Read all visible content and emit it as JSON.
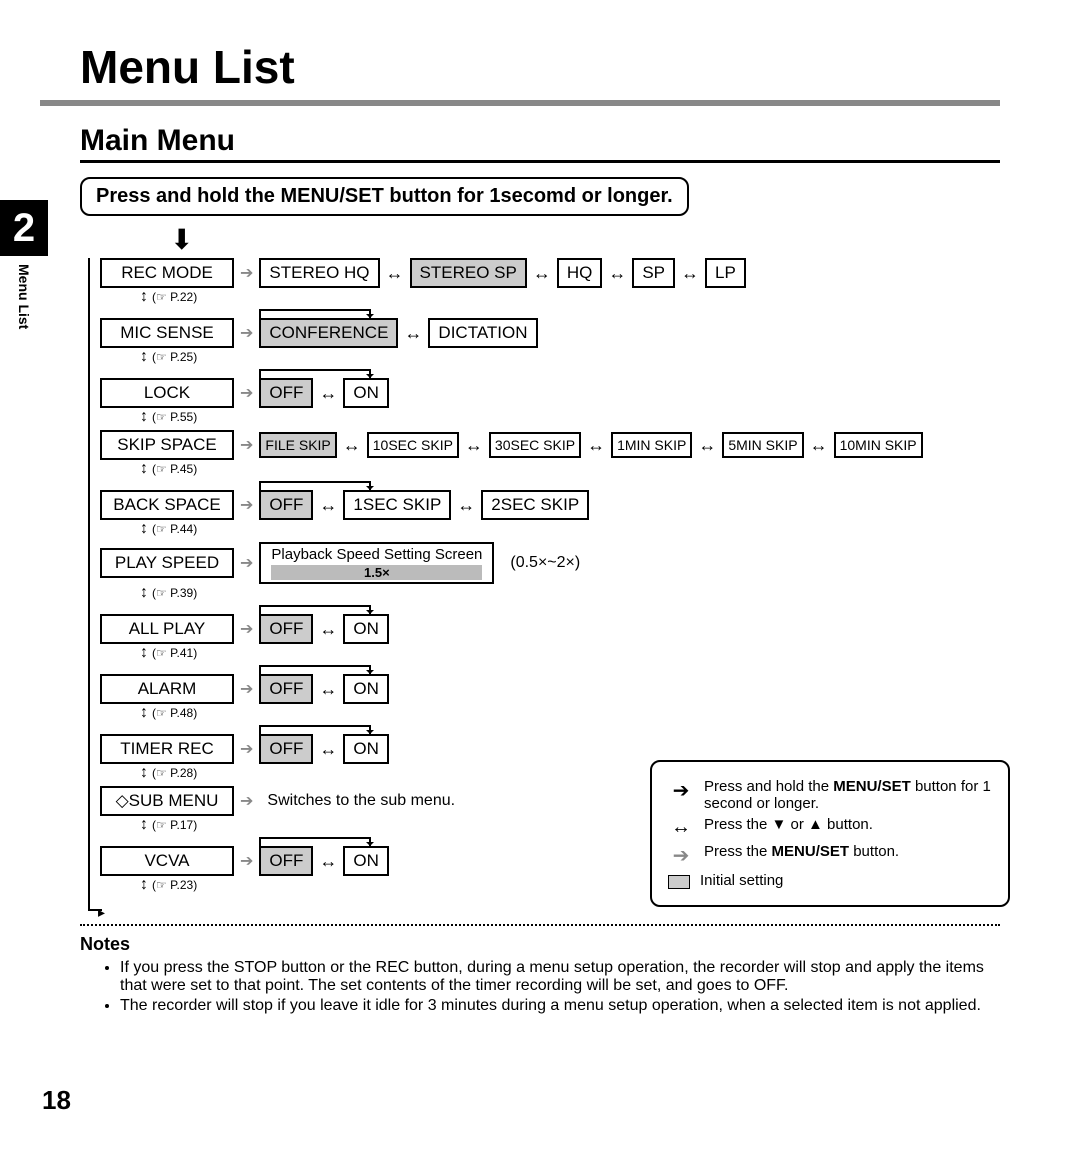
{
  "page": {
    "title": "Menu List",
    "subtitle": "Main Menu",
    "instruction": "Press and hold the MENU/SET button for 1secomd or longer.",
    "section_number": "2",
    "side_label": "Menu List",
    "page_number": "18"
  },
  "menu": [
    {
      "label": "REC MODE",
      "ref": "(☞ P.22)",
      "options": [
        "STEREO HQ",
        "STEREO SP",
        "HQ",
        "SP",
        "LP"
      ],
      "initial_idx": 1
    },
    {
      "label": "MIC SENSE",
      "ref": "(☞ P.25)",
      "options": [
        "CONFERENCE",
        "DICTATION"
      ],
      "initial_idx": 0,
      "loop": true
    },
    {
      "label": "LOCK",
      "ref": "(☞ P.55)",
      "options": [
        "OFF",
        "ON"
      ],
      "initial_idx": 0,
      "loop": true
    },
    {
      "label": "SKIP SPACE",
      "ref": "(☞ P.45)",
      "options": [
        "FILE SKIP",
        "10SEC SKIP",
        "30SEC SKIP",
        "1MIN SKIP",
        "5MIN SKIP",
        "10MIN SKIP"
      ],
      "initial_idx": 0,
      "small": true
    },
    {
      "label": "BACK SPACE",
      "ref": "(☞ P.44)",
      "options": [
        "OFF",
        "1SEC SKIP",
        "2SEC SKIP"
      ],
      "initial_idx": 0,
      "loop": true
    },
    {
      "label": "PLAY SPEED",
      "ref": "(☞ P.39)",
      "screen_label": "Playback Speed Setting Screen",
      "screen_value": "1.5×",
      "range": "(0.5×~2×)"
    },
    {
      "label": "ALL PLAY",
      "ref": "(☞ P.41)",
      "options": [
        "OFF",
        "ON"
      ],
      "initial_idx": 0,
      "loop": true
    },
    {
      "label": "ALARM",
      "ref": "(☞ P.48)",
      "options": [
        "OFF",
        "ON"
      ],
      "initial_idx": 0,
      "loop": true
    },
    {
      "label": "TIMER REC",
      "ref": "(☞ P.28)",
      "options": [
        "OFF",
        "ON"
      ],
      "initial_idx": 0,
      "loop": true
    },
    {
      "label": "◇SUB MENU",
      "ref": "(☞ P.17)",
      "subtext": "Switches to the sub menu."
    },
    {
      "label": "VCVA",
      "ref": "(☞ P.23)",
      "options": [
        "OFF",
        "ON"
      ],
      "initial_idx": 0,
      "loop": true
    }
  ],
  "legend": {
    "hold_pre": "Press and hold the ",
    "hold_bold": "MENU/SET",
    "hold_post": " button for 1 second or longer.",
    "updown": "Press the ▼ or ▲ button.",
    "press_pre": "Press the ",
    "press_bold": "MENU/SET",
    "press_post": " button.",
    "initial": "Initial setting"
  },
  "notes": {
    "heading": "Notes",
    "items": [
      "If you press the STOP button or the REC button, during a menu setup operation, the recorder will stop and apply the items that were set to that point. The set contents of the timer recording will be set, and goes to OFF.",
      "The recorder will stop if you leave it idle for 3 minutes during a menu setup operation, when a selected item is not applied."
    ]
  }
}
